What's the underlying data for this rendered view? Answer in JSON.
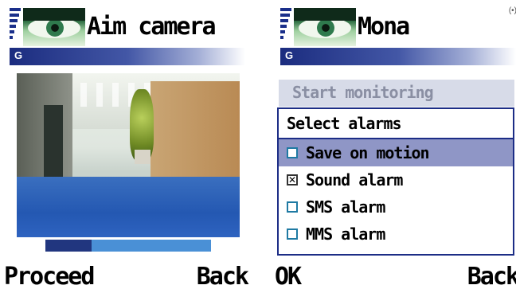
{
  "left_screen": {
    "title": "Aim camera",
    "network": "G",
    "progress": 0.28,
    "softkeys": {
      "left": "Proceed",
      "right": "Back"
    }
  },
  "right_screen": {
    "title": "Mona",
    "network": "G",
    "indicator": "(•)",
    "menu_item": "Start monitoring",
    "dialog": {
      "title": "Select alarms",
      "options": [
        {
          "label": "Save on motion",
          "checked": false,
          "highlighted": true
        },
        {
          "label": "Sound alarm",
          "checked": true,
          "highlighted": false
        },
        {
          "label": "SMS alarm",
          "checked": false,
          "highlighted": false
        },
        {
          "label": "MMS alarm",
          "checked": false,
          "highlighted": false
        }
      ]
    },
    "softkeys": {
      "left": "OK",
      "right": "Back"
    }
  },
  "icons": {
    "signal": "signal-strength-icon",
    "app": "eye-app-icon",
    "unchecked": "checkbox-unchecked-icon",
    "checked": "checkbox-checked-icon"
  },
  "colors": {
    "accent": "#1c2d86",
    "highlight": "#8f96c6",
    "progress_track": "#4a90d6",
    "progress_fill": "#21367f"
  }
}
